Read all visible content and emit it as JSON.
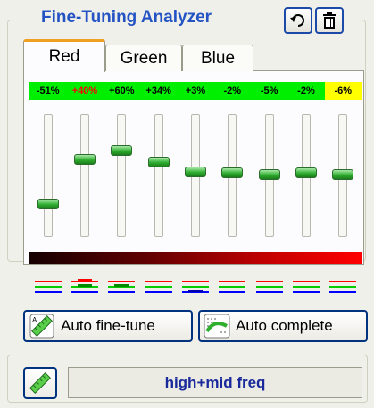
{
  "header": {
    "title": "Fine-Tuning Analyzer",
    "undo_icon": "undo-icon",
    "trash_icon": "trash-icon"
  },
  "tabs": [
    {
      "label": "Red",
      "selected": true
    },
    {
      "label": "Green",
      "selected": false
    },
    {
      "label": "Blue",
      "selected": false
    }
  ],
  "bands": [
    {
      "pct": "-51%",
      "level": 0.27,
      "bg": "#00ee00",
      "fg": "#000000"
    },
    {
      "pct": "+40%",
      "level": 0.63,
      "bg": "#00ee00",
      "fg": "#ff0000"
    },
    {
      "pct": "+60%",
      "level": 0.7,
      "bg": "#00ee00",
      "fg": "#000000"
    },
    {
      "pct": "+34%",
      "level": 0.61,
      "bg": "#00ee00",
      "fg": "#000000"
    },
    {
      "pct": "+3%",
      "level": 0.53,
      "bg": "#00ee00",
      "fg": "#000000"
    },
    {
      "pct": "-2%",
      "level": 0.52,
      "bg": "#00ee00",
      "fg": "#000000"
    },
    {
      "pct": "-5%",
      "level": 0.51,
      "bg": "#00ee00",
      "fg": "#000000"
    },
    {
      "pct": "-2%",
      "level": 0.52,
      "bg": "#00ee00",
      "fg": "#000000"
    },
    {
      "pct": "-6%",
      "level": 0.51,
      "bg": "#ffff00",
      "fg": "#000000"
    }
  ],
  "buttons": {
    "auto_finetune": "Auto fine-tune",
    "auto_complete": "Auto complete"
  },
  "status": {
    "text": "high+mid freq"
  },
  "colors": {
    "title": "#2454c4",
    "accent_tab": "#f0a020",
    "thumb": "#2fae2f"
  }
}
